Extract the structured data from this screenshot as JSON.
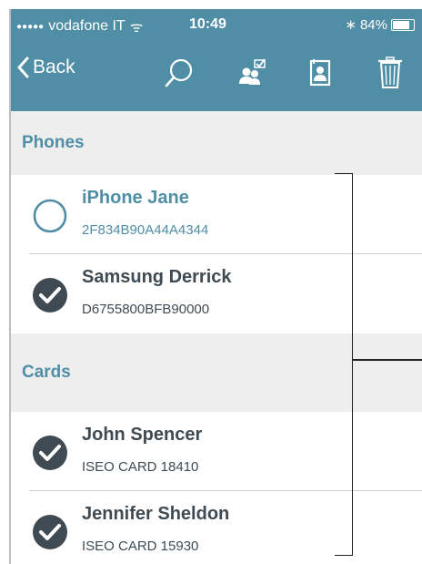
{
  "status": {
    "signal_dots": "●●●●●",
    "carrier": "vodafone IT",
    "wifi_glyph": "ᯤ",
    "time": "10:49",
    "bluetooth_glyph": "∗",
    "battery_text": "84%",
    "battery_level": 0.84
  },
  "nav": {
    "back_label": "Back",
    "icons": [
      "search-icon",
      "users-check-icon",
      "contact-card-icon",
      "trash-icon"
    ]
  },
  "sections": [
    {
      "header": "Phones",
      "items": [
        {
          "title": "iPhone Jane",
          "subtitle": "2F834B90A44A4344",
          "selected": false
        },
        {
          "title": "Samsung Derrick",
          "subtitle": "D6755800BFB90000",
          "selected": true
        }
      ]
    },
    {
      "header": "Cards",
      "items": [
        {
          "title": "John Spencer",
          "subtitle": "ISEO CARD 18410",
          "selected": true
        },
        {
          "title": "Jennifer Sheldon",
          "subtitle": "ISEO CARD 15930",
          "selected": true
        }
      ]
    }
  ],
  "colors": {
    "accent": "#4f8ea5",
    "dark": "#3f4a53",
    "header_bg": "#eeeeee"
  }
}
